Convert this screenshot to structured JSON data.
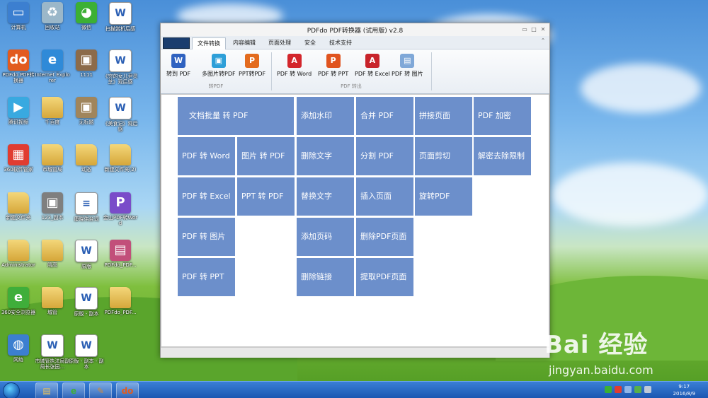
{
  "desktop_icons": [
    {
      "label": "计算机",
      "icon": "computer-icon",
      "color": "#3c7fd0",
      "glyph": "▭"
    },
    {
      "label": "回收站",
      "icon": "recycle-bin-icon",
      "color": "#9bb7c9",
      "glyph": "♻"
    },
    {
      "label": "微信",
      "icon": "wechat-icon",
      "color": "#3cb034",
      "glyph": "◕"
    },
    {
      "label": "扫描赏析后感",
      "icon": "word-doc-icon",
      "color": "#ffffff",
      "glyph": "W"
    },
    {
      "label": "PDFdo PDF转换器",
      "icon": "pdfdo-icon",
      "color": "#e25b1f",
      "glyph": "do"
    },
    {
      "label": "Internet Explorer",
      "icon": "ie-icon",
      "color": "#2f8ad8",
      "glyph": "e"
    },
    {
      "label": "1111",
      "icon": "image-icon",
      "color": "#8c6b4a",
      "glyph": "▣"
    },
    {
      "label": "《穷的女儿尹灵芝》观后感",
      "icon": "word-doc-icon",
      "color": "#ffffff",
      "glyph": "W"
    },
    {
      "label": "腾讯视频",
      "icon": "tencent-video-icon",
      "color": "#39a9e0",
      "glyph": "▶"
    },
    {
      "label": "千百度",
      "icon": "folder-icon",
      "color": "#e0b44c",
      "glyph": ""
    },
    {
      "label": "无标题",
      "icon": "image-icon",
      "color": "#a0855c",
      "glyph": "▣"
    },
    {
      "label": "《美食记》观后感",
      "icon": "word-doc-icon",
      "color": "#ffffff",
      "glyph": "W"
    },
    {
      "label": "360软件管家",
      "icon": "360-manager-icon",
      "color": "#e03c31",
      "glyph": "▦"
    },
    {
      "label": "市城管局",
      "icon": "folder-icon",
      "color": "#e0b44c",
      "glyph": ""
    },
    {
      "label": "动态",
      "icon": "folder-icon",
      "color": "#e0b44c",
      "glyph": ""
    },
    {
      "label": "新建文件夹(2)",
      "icon": "folder-icon",
      "color": "#e0b44c",
      "glyph": ""
    },
    {
      "label": "新建文件夹",
      "icon": "folder-icon",
      "color": "#e0b44c",
      "glyph": ""
    },
    {
      "label": "123_副本",
      "icon": "image-icon",
      "color": "#7f7f7f",
      "glyph": "▣"
    },
    {
      "label": "康晓伟台词",
      "icon": "text-doc-icon",
      "color": "#ffffff",
      "glyph": "≡"
    },
    {
      "label": "金山PDF转Word",
      "icon": "wps-pdf-icon",
      "color": "#7a4cc9",
      "glyph": "P"
    },
    {
      "label": "Administrator",
      "icon": "user-folder-icon",
      "color": "#e0b44c",
      "glyph": ""
    },
    {
      "label": "隋高",
      "icon": "folder-icon",
      "color": "#e0b44c",
      "glyph": ""
    },
    {
      "label": "原版",
      "icon": "word-doc-icon",
      "color": "#ffffff",
      "glyph": "W"
    },
    {
      "label": "PDFdo_PDF...",
      "icon": "archive-icon",
      "color": "#c24f7a",
      "glyph": "▤"
    },
    {
      "label": "360安全浏览器",
      "icon": "360-browser-icon",
      "color": "#3fae3a",
      "glyph": "e"
    },
    {
      "label": "城管",
      "icon": "folder-icon",
      "color": "#e0b44c",
      "glyph": ""
    },
    {
      "label": "原版 - 副本",
      "icon": "word-doc-icon",
      "color": "#ffffff",
      "glyph": "W"
    },
    {
      "label": "PDFdo_PDF...",
      "icon": "folder-icon",
      "color": "#e0b44c",
      "glyph": ""
    },
    {
      "label": "网络",
      "icon": "network-icon",
      "color": "#3c7fd0",
      "glyph": "◍"
    },
    {
      "label": "市城管执法局副局长张园...",
      "icon": "word-doc-icon",
      "color": "#ffffff",
      "glyph": "W"
    },
    {
      "label": "原版 - 副本 - 副本",
      "icon": "word-doc-icon",
      "color": "#ffffff",
      "glyph": "W"
    }
  ],
  "window": {
    "title": "PDFdo  PDF转换器  (试用版)  v2.8",
    "controls": {
      "minimize": "▭",
      "maximize": "□",
      "close": "✕",
      "collapse": "⌃"
    },
    "tabs": [
      "文件转换",
      "内容编辑",
      "页面处理",
      "安全",
      "技术支持"
    ],
    "ribbon_groups": [
      {
        "name": "转PDF",
        "buttons": [
          {
            "label": "转到 PDF",
            "icon": "word-to-pdf-icon",
            "color": "#2f62c0",
            "glyph": "W"
          },
          {
            "label": "多图片转PDF",
            "icon": "images-to-pdf-icon",
            "color": "#2d9fd8",
            "glyph": "▣"
          },
          {
            "label": "PPT转PDF",
            "icon": "ppt-to-pdf-icon",
            "color": "#e36b1e",
            "glyph": "P"
          }
        ]
      },
      {
        "name": "PDF 转出",
        "buttons": [
          {
            "label": "PDF 转 Word",
            "icon": "pdf-to-word-icon",
            "color": "#d3262c",
            "glyph": "A"
          },
          {
            "label": "PDF 转 PPT",
            "icon": "pdf-to-ppt-icon",
            "color": "#e0541f",
            "glyph": "P"
          },
          {
            "label": "PDF 转 Excel",
            "icon": "pdf-to-excel-icon",
            "color": "#c8242b",
            "glyph": "A"
          },
          {
            "label": "PDF 转 图片",
            "icon": "pdf-to-image-icon",
            "color": "#7fa8d8",
            "glyph": "▤"
          }
        ]
      }
    ],
    "tiles": [
      {
        "label": "文档批量 转 PDF",
        "name": "batch-to-pdf"
      },
      {
        "label": "添加水印",
        "name": "add-watermark"
      },
      {
        "label": "合并 PDF",
        "name": "merge-pdf"
      },
      {
        "label": "拼接页面",
        "name": "join-pages"
      },
      {
        "label": "PDF 加密",
        "name": "pdf-encrypt"
      },
      {
        "label": "PDF 转 Word",
        "name": "pdf-to-word"
      },
      {
        "label": "图片 转 PDF",
        "name": "image-to-pdf"
      },
      {
        "label": "删除文字",
        "name": "delete-text"
      },
      {
        "label": "分割 PDF",
        "name": "split-pdf"
      },
      {
        "label": "页面剪切",
        "name": "page-crop"
      },
      {
        "label": "解密去除限制",
        "name": "decrypt-remove-restriction"
      },
      {
        "label": "PDF 转 Excel",
        "name": "pdf-to-excel"
      },
      {
        "label": "PPT 转 PDF",
        "name": "ppt-to-pdf"
      },
      {
        "label": "替换文字",
        "name": "replace-text"
      },
      {
        "label": "插入页面",
        "name": "insert-page"
      },
      {
        "label": "旋转PDF",
        "name": "rotate-pdf"
      },
      {
        "label": "PDF 转 图片",
        "name": "pdf-to-image"
      },
      {
        "label": "添加页码",
        "name": "add-page-number"
      },
      {
        "label": "删除PDF页面",
        "name": "delete-pdf-page"
      },
      {
        "label": "PDF 转 PPT",
        "name": "pdf-to-ppt"
      },
      {
        "label": "删除链接",
        "name": "delete-links"
      },
      {
        "label": "提取PDF页面",
        "name": "extract-pdf-page"
      }
    ],
    "tile_color": "#6c8fcb"
  },
  "taskbar": {
    "apps": [
      {
        "icon": "explorer-icon",
        "glyph": "▤",
        "color": "#e8c15a"
      },
      {
        "icon": "360-browser-icon",
        "glyph": "e",
        "color": "#3fae3a"
      },
      {
        "icon": "paint-icon",
        "glyph": "✎",
        "color": "#d08a3c"
      },
      {
        "icon": "pdfdo-icon",
        "glyph": "do",
        "color": "#e25b1f"
      }
    ],
    "time": "9:17",
    "date": "2016/8/9"
  },
  "watermark": {
    "brand": "Bai  经验",
    "url": "jingyan.baidu.com"
  }
}
